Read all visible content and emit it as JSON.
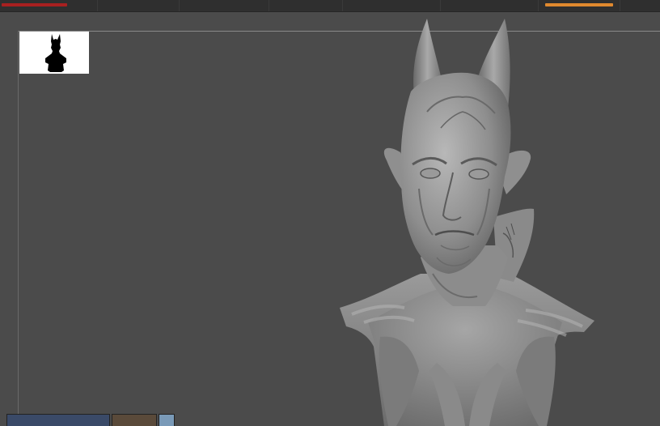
{
  "app": {
    "viewport_background": "#4b4b4b",
    "toolbar_background": "#2f2f2f"
  },
  "status": {
    "left_progress_color": "#a82020",
    "right_progress_color": "#e0892e"
  },
  "navigator": {
    "icon": "bust-silhouette-icon"
  },
  "model": {
    "icon": "sculpted-demon-bust-icon"
  },
  "tray": {
    "items": [
      {
        "icon": "scene-thumbnail-icon"
      },
      {
        "icon": "scene-thumbnail-icon"
      },
      {
        "icon": "scene-thumbnail-icon"
      }
    ]
  }
}
